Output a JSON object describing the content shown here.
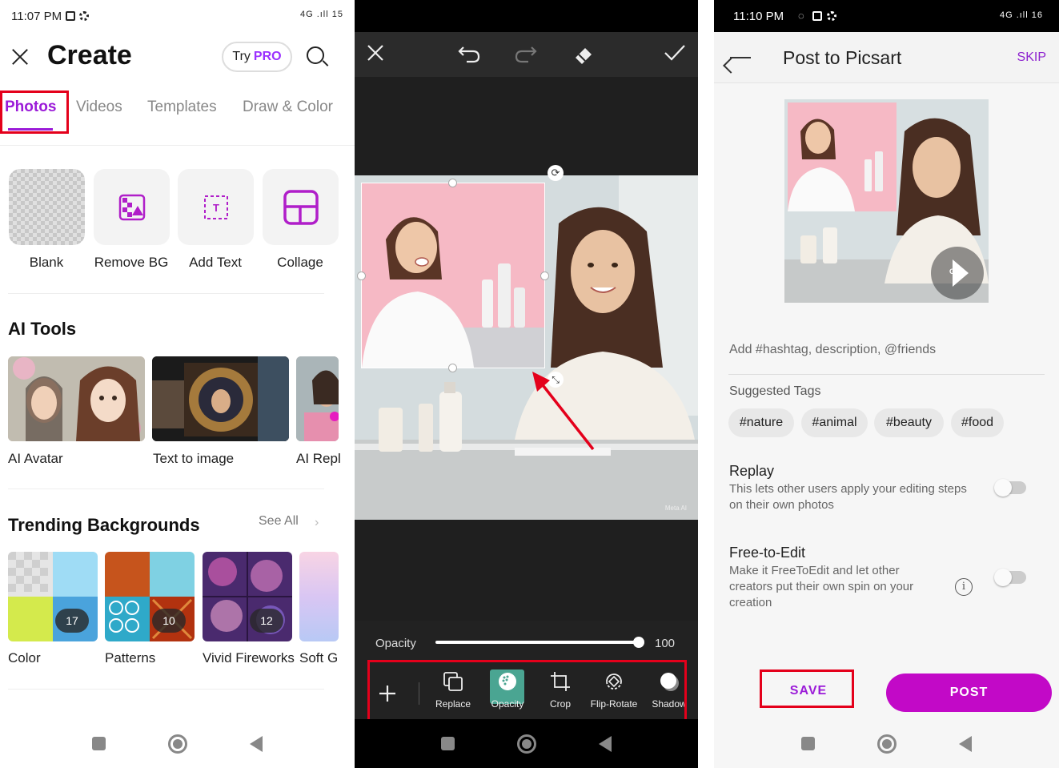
{
  "panel1": {
    "status_time": "11:07 PM",
    "status_right": "4G .ıll 15",
    "title": "Create",
    "try_label": "Try",
    "pro_label": "PRO",
    "tabs": [
      "Photos",
      "Videos",
      "Templates",
      "Draw & Color"
    ],
    "tools": [
      "Blank",
      "Remove BG",
      "Add Text",
      "Collage"
    ],
    "ai_section_title": "AI Tools",
    "ai_items": [
      "AI Avatar",
      "Text to image",
      "AI Repl"
    ],
    "trending_title": "Trending Backgrounds",
    "see_all": "See All",
    "backgrounds": [
      {
        "label": "Color",
        "count": "17"
      },
      {
        "label": "Patterns",
        "count": "10"
      },
      {
        "label": "Vivid Fireworks",
        "count": "12"
      },
      {
        "label": "Soft G",
        "count": ""
      }
    ]
  },
  "panel2": {
    "opacity_label": "Opacity",
    "opacity_value": "100",
    "watermark": "Meta AI",
    "tools": [
      "Replace",
      "Opacity",
      "Crop",
      "Flip-Rotate",
      "Shadow"
    ]
  },
  "panel3": {
    "status_time": "11:10 PM",
    "status_right": "4G .ıll 16",
    "title": "Post to Picsart",
    "skip": "SKIP",
    "gif_label": "GIF",
    "description_placeholder": "Add #hashtag, description, @friends",
    "suggested_tags_label": "Suggested Tags",
    "tags": [
      "#nature",
      "#animal",
      "#beauty",
      "#food"
    ],
    "replay_title": "Replay",
    "replay_desc": "This lets other users apply your editing steps on their own photos",
    "free_title": "Free-to-Edit",
    "free_desc": "Make it FreeToEdit and let other creators put their own spin on your creation",
    "save_label": "SAVE",
    "post_label": "POST"
  },
  "colors": {
    "accent_purple": "#9b1bd8",
    "post_magenta": "#c209c7",
    "highlight_red": "#e4001b",
    "opacity_selected": "#4aa592"
  }
}
